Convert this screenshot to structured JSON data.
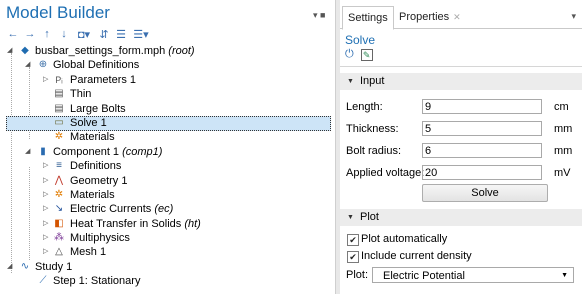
{
  "model_builder": {
    "title": "Model Builder",
    "pin_icons": "▾ ■",
    "toolbar_icons": [
      "←",
      "→",
      "↑",
      "↓",
      "◘▾",
      "⇵",
      "☰",
      "☰▾"
    ]
  },
  "tree": {
    "root": {
      "label": "busbar_settings_form.mph",
      "tag": "(root)"
    },
    "global": "Global Definitions",
    "parameters": "Parameters 1",
    "thin": "Thin",
    "large_bolts": "Large Bolts",
    "solve": "Solve 1",
    "materials_global": "Materials",
    "component": {
      "label": "Component 1",
      "tag": "(comp1)"
    },
    "definitions": "Definitions",
    "geometry": "Geometry 1",
    "materials": "Materials",
    "electric_currents": {
      "label": "Electric Currents",
      "tag": "(ec)"
    },
    "heat_transfer": {
      "label": "Heat Transfer in Solids",
      "tag": "(ht)"
    },
    "multiphysics": "Multiphysics",
    "mesh": "Mesh 1",
    "study": "Study 1",
    "step": "Step 1: Stationary"
  },
  "settings": {
    "tab_settings": "Settings",
    "tab_properties": "Properties",
    "tab_close": "✕",
    "panel_menu": "▾",
    "heading": "Solve",
    "input_section": "Input",
    "fields": {
      "length": {
        "label": "Length:",
        "value": "9",
        "unit": "cm"
      },
      "thickness": {
        "label": "Thickness:",
        "value": "5",
        "unit": "mm"
      },
      "bolt_radius": {
        "label": "Bolt radius:",
        "value": "6",
        "unit": "mm"
      },
      "voltage": {
        "label": "Applied voltage:",
        "value": "20",
        "unit": "mV"
      }
    },
    "solve_button": "Solve",
    "plot_section": "Plot",
    "plot_auto": {
      "label": "Plot automatically",
      "checked": true
    },
    "include_current": {
      "label": "Include current density",
      "checked": true
    },
    "plot_select": {
      "label": "Plot:",
      "value": "Electric Potential"
    }
  },
  "colors": {
    "accent": "#1e6fb3",
    "selection": "#cde4f7",
    "section_bg": "#ececec"
  }
}
